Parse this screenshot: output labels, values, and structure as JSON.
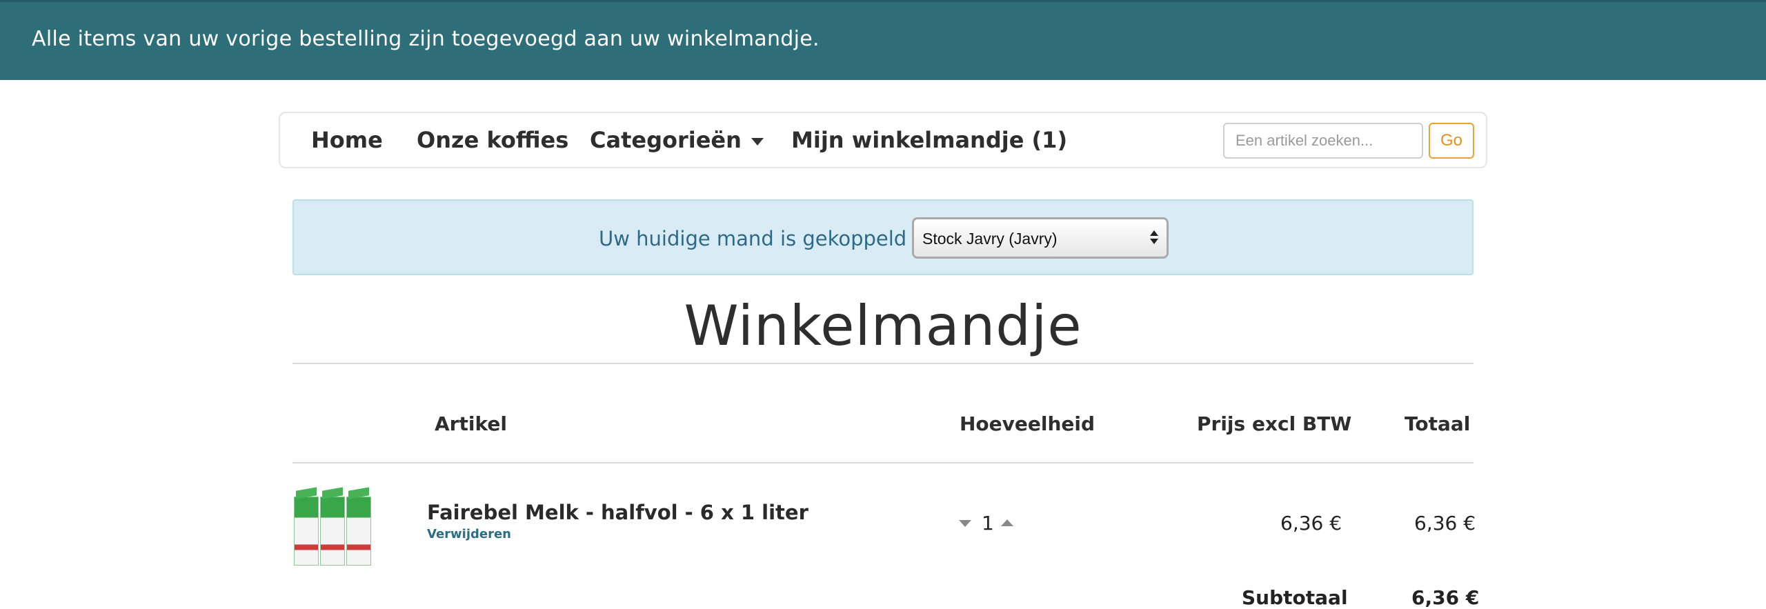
{
  "notice": {
    "message": "Alle items van uw vorige bestelling zijn toegevoegd aan uw winkelmandje."
  },
  "nav": {
    "items": [
      {
        "label": "Home"
      },
      {
        "label": "Onze koffies"
      },
      {
        "label": "Categorieën",
        "has_dropdown": true
      },
      {
        "label": "Mijn winkelmandje (1)"
      }
    ],
    "search": {
      "placeholder": "Een artikel zoeken...",
      "value": "",
      "button_label": "Go"
    }
  },
  "cart_link": {
    "label": "Uw huidige mand is gekoppeld aan",
    "selected_option": "Stock Javry (Javry)"
  },
  "page": {
    "title": "Winkelmandje"
  },
  "table": {
    "headers": {
      "article": "Artikel",
      "quantity": "Hoeveelheid",
      "price": "Prijs excl BTW",
      "total": "Totaal"
    },
    "rows": [
      {
        "name": "Fairebel Melk - halfvol - 6 x 1 liter",
        "remove_label": "Verwijderen",
        "quantity": "1",
        "price": "6,36 €",
        "total": "6,36 €"
      }
    ]
  },
  "summary": {
    "subtotal_label": "Subtotaal",
    "subtotal_value": "6,36 €"
  },
  "colors": {
    "notice_bg": "#2e6e78",
    "info_bar_bg": "#d9ecf5",
    "accent_orange": "#f0a030",
    "link_blue": "#2b6d86"
  }
}
